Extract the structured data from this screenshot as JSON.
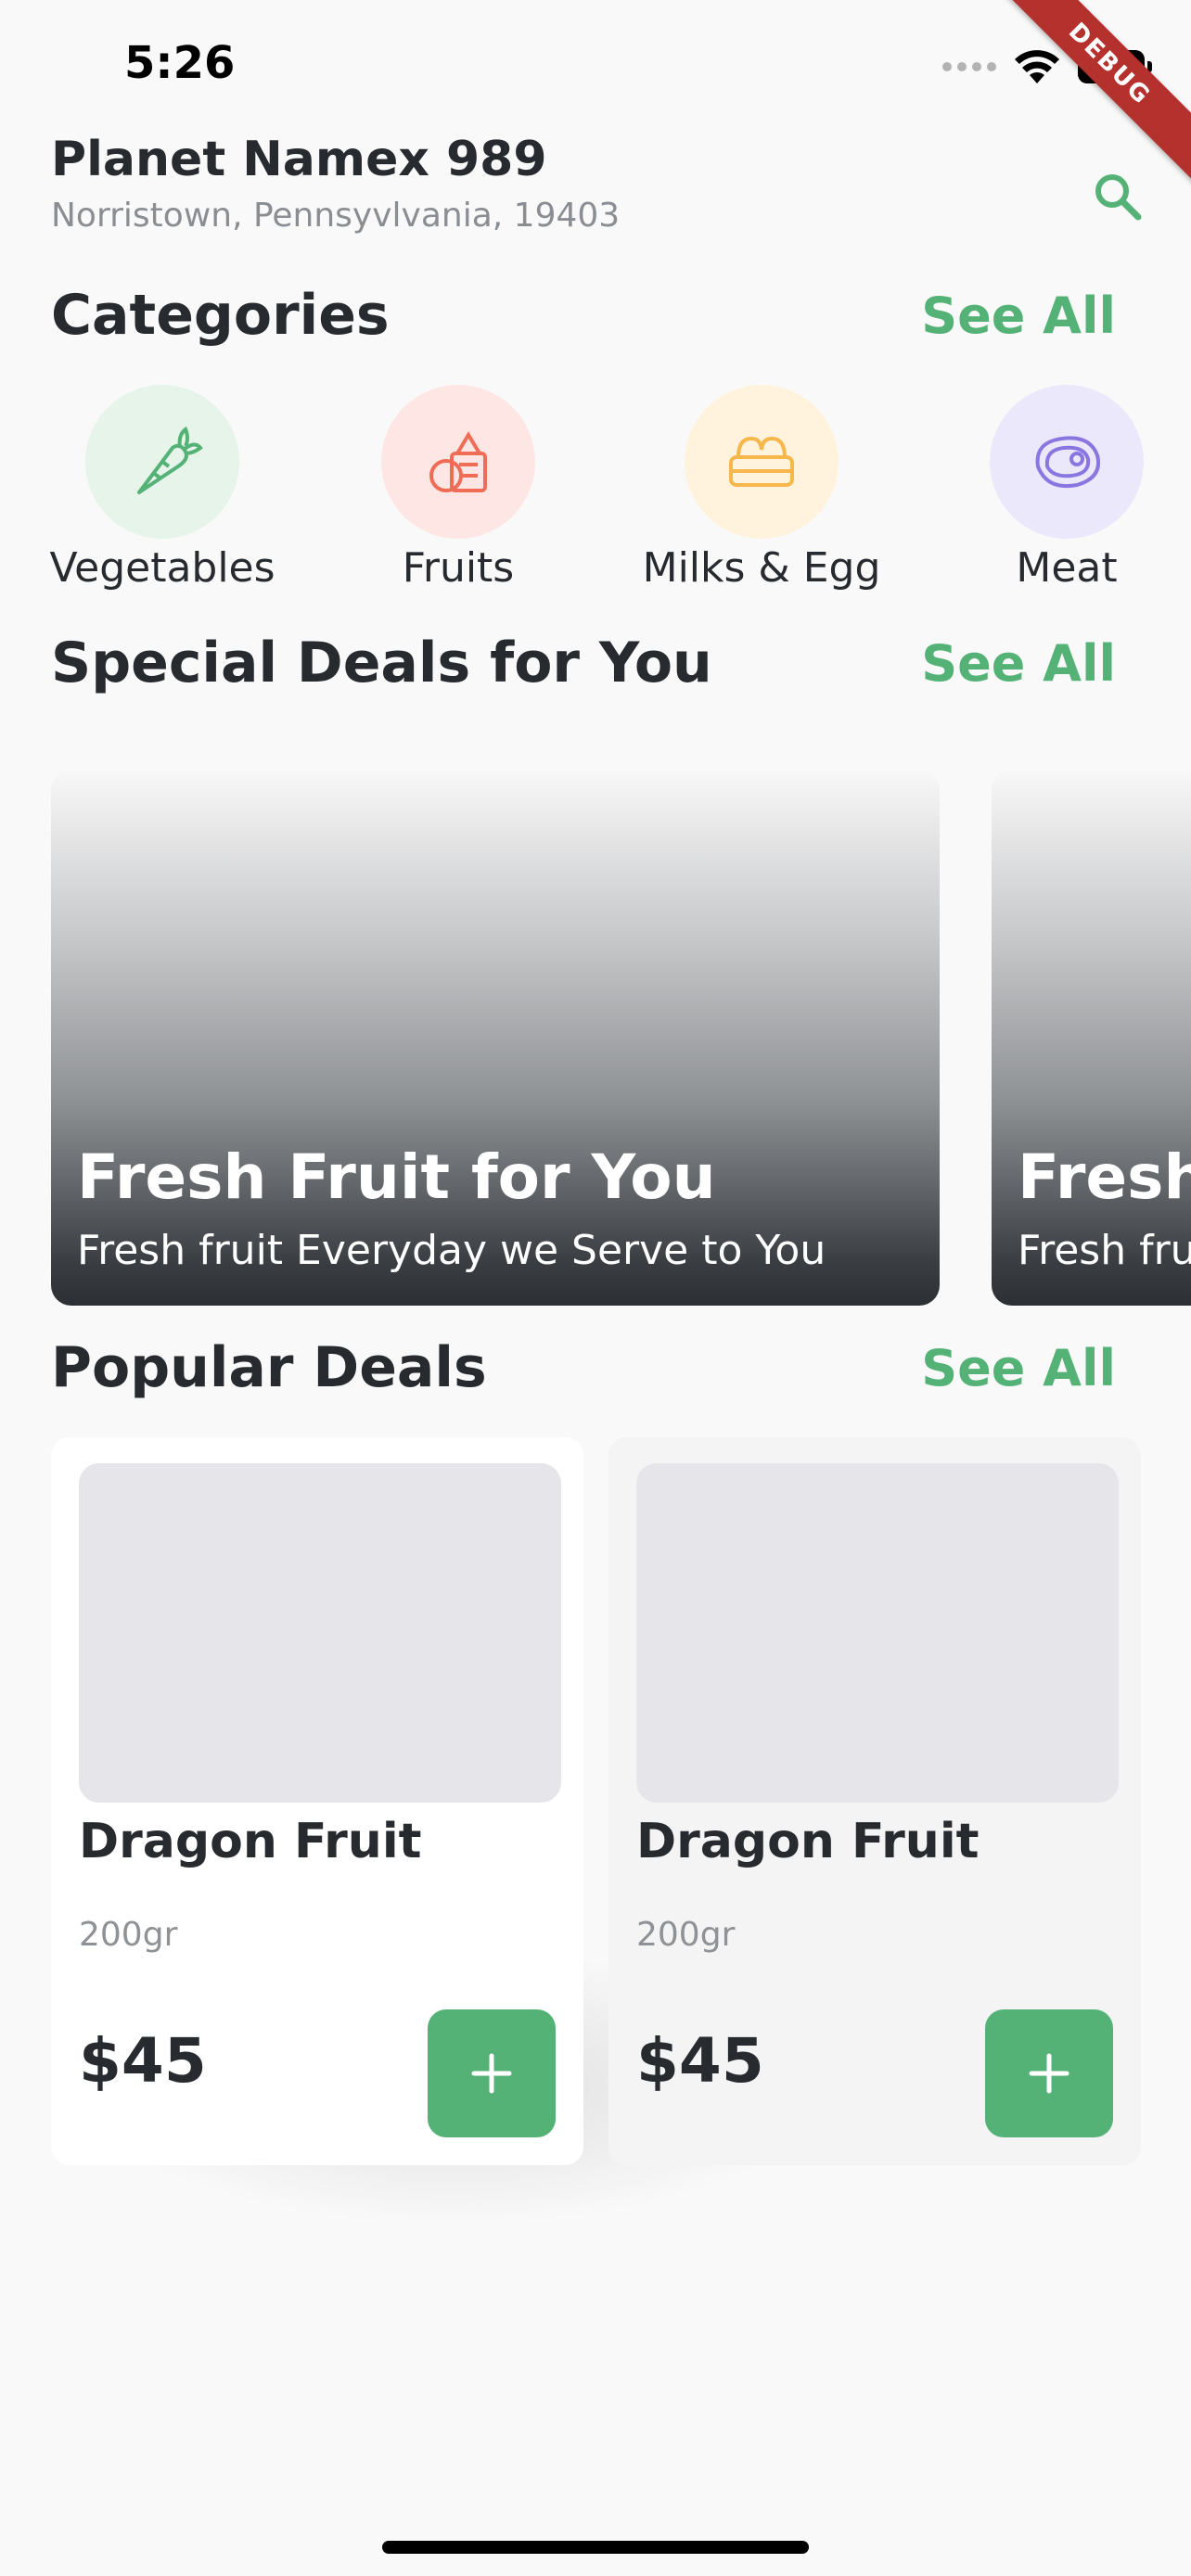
{
  "status_bar": {
    "time": "5:26"
  },
  "debug_banner": "DEBUG",
  "header": {
    "store_name": "Planet Namex 989",
    "address": "Norristown, Pennsyvlvania, 19403",
    "search_icon": "search-icon"
  },
  "categories": {
    "title": "Categories",
    "see_all": "See All",
    "items": [
      {
        "label": "Vegetables",
        "icon": "carrot-icon",
        "bg": "#e6f4ea",
        "color": "#55b276"
      },
      {
        "label": "Fruits",
        "icon": "fruit-basket-icon",
        "bg": "#fde6e3",
        "color": "#f06c56"
      },
      {
        "label": "Milks & Egg",
        "icon": "egg-carton-icon",
        "bg": "#fff3dd",
        "color": "#f8b74b"
      },
      {
        "label": "Meat",
        "icon": "steak-icon",
        "bg": "#ece8fb",
        "color": "#8a76e0"
      }
    ]
  },
  "special_deals": {
    "title": "Special Deals for You",
    "see_all": "See All",
    "cards": [
      {
        "title": "Fresh Fruit for You",
        "subtitle": "Fresh fruit Everyday we Serve to You"
      },
      {
        "title": "Fresh Fruit for You",
        "subtitle": "Fresh fruit Everyday we Serve to You"
      }
    ]
  },
  "popular_deals": {
    "title": "Popular Deals",
    "see_all": "See All",
    "products": [
      {
        "name": "Dragon Fruit",
        "weight": "200gr",
        "price": "$45"
      },
      {
        "name": "Dragon Fruit",
        "weight": "200gr",
        "price": "$45"
      }
    ]
  },
  "colors": {
    "accent": "#55b276",
    "text": "#272a2e",
    "muted": "#8a8e93",
    "background": "#f9f9f9"
  }
}
